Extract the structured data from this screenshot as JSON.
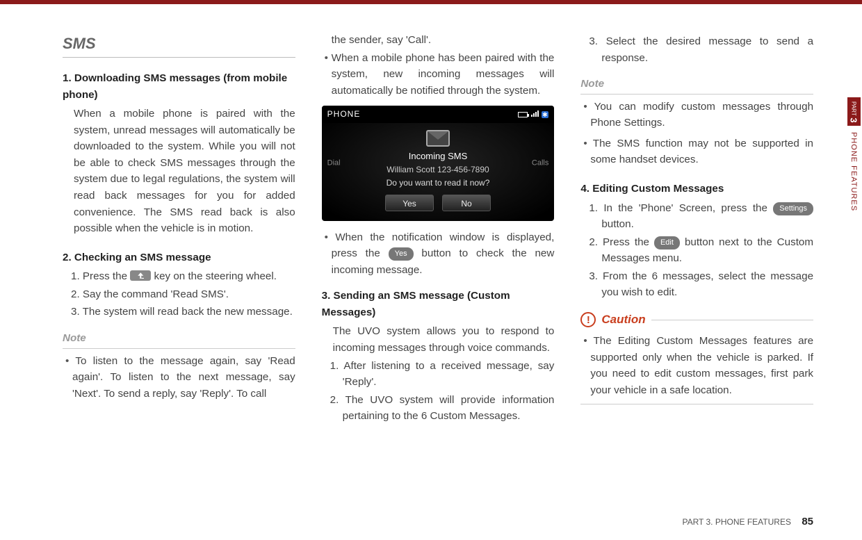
{
  "section_title": "SMS",
  "col1": {
    "h1": "1. Downloading SMS messages (from mobile phone)",
    "p1": "When a mobile phone is paired with the system, unread messages will automatically be downloaded to the system. While you will not be able to check SMS messages through the system due to legal regulations, the system will read back messages for you for added convenience. The SMS read back is also possible when the vehicle is in motion.",
    "h2": "2. Checking an SMS message",
    "s1a": "1. Press the ",
    "s1b": " key on the steering wheel.",
    "s2": "2. Say the command 'Read SMS'.",
    "s3": "3. The system will read back the new message.",
    "note": "Note",
    "b1": "To listen to the message again, say 'Read again'. To listen to the next message, say 'Next'. To send a reply, say 'Reply'. To call"
  },
  "col2": {
    "p0": "the sender, say 'Call'.",
    "b1": "When a mobile phone has been paired with the system, new incoming messages will automatically be notified through the system.",
    "phone": {
      "title": "PHONE",
      "left": "Dial",
      "right": "Calls",
      "line1": "Incoming SMS",
      "line2": "William Scott 123-456-7890",
      "line3": "Do you want to read it now?",
      "yes": "Yes",
      "no": "No"
    },
    "b2a": "When the notification window is displayed, press the ",
    "yes_btn": "Yes",
    "b2b": " button to check the new incoming message.",
    "h3": "3. Sending an SMS message (Custom Messages)",
    "p3": "The UVO system allows you to respond to incoming messages through voice commands.",
    "s1": "1. After listening to a received message, say 'Reply'.",
    "s2": "2. The UVO system will provide information pertaining to the 6 Custom Messages."
  },
  "col3": {
    "s3": "3. Select the desired message to send a response.",
    "note": "Note",
    "nb1": "You can modify custom messages through Phone Settings.",
    "nb2": "The SMS function may not be supported in some handset devices.",
    "h4": "4. Editing Custom Messages",
    "s4a": "1. In the 'Phone' Screen, press the ",
    "settings_btn": "Settings",
    "s4b": " button.",
    "s5a": "2. Press the ",
    "edit_btn": "Edit",
    "s5b": " button next to the Custom Messages menu.",
    "s6": "3. From the 6 messages, select the message you wish to edit.",
    "caution": "Caution",
    "cb": "The Editing Custom Messages features are supported only when the vehicle is parked. If you need to edit custom messages, first park your vehicle in a safe location."
  },
  "side": {
    "partword": "PART",
    "partnum": "3",
    "label": "PHONE FEATURES"
  },
  "footer": {
    "text": "PART 3. PHONE FEATURES",
    "page": "85"
  }
}
